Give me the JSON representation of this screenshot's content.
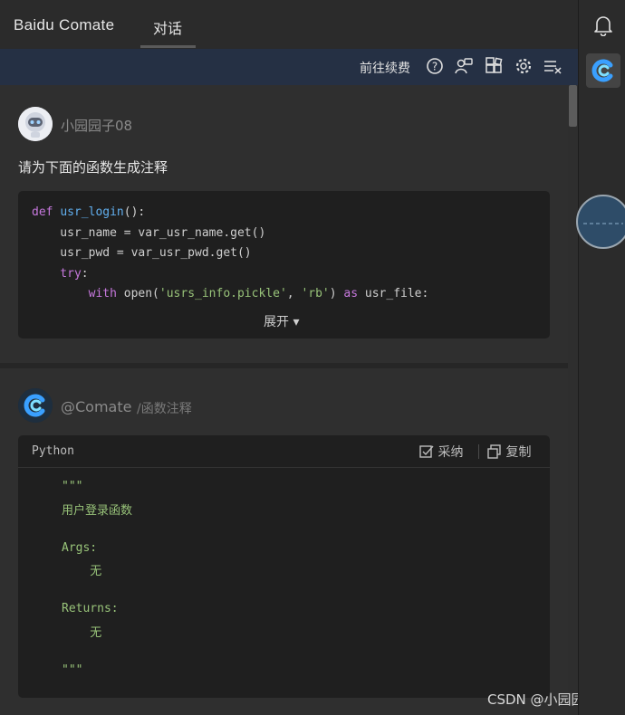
{
  "header": {
    "brand": "Baidu Comate",
    "tab": "对话"
  },
  "toolbar": {
    "renew_label": "前往续费",
    "icons": [
      "help-icon",
      "feedback-icon",
      "plugin-icon",
      "settings-icon",
      "clear-icon"
    ]
  },
  "user_message": {
    "username": "小园园子08",
    "question": "请为下面的函数生成注释",
    "code_lines": [
      {
        "parts": [
          [
            "kw",
            "def "
          ],
          [
            "fn",
            "usr_login"
          ],
          [
            "",
            "():"
          ]
        ]
      },
      {
        "parts": [
          [
            "",
            "    usr_name = var_usr_name.get()"
          ]
        ]
      },
      {
        "parts": [
          [
            "",
            "    usr_pwd = var_usr_pwd.get()"
          ]
        ]
      },
      {
        "parts": [
          [
            "kw",
            "    try"
          ],
          [
            "",
            ":"
          ]
        ]
      },
      {
        "parts": [
          [
            "kw",
            "        with "
          ],
          [
            "",
            "open("
          ],
          [
            "str",
            "'usrs_info.pickle'"
          ],
          [
            "",
            ", "
          ],
          [
            "str",
            "'rb'"
          ],
          [
            "",
            ") "
          ],
          [
            "kw",
            "as"
          ],
          [
            "",
            " usr_file:"
          ]
        ]
      }
    ],
    "expand_label": "展开 ▾"
  },
  "bot_message": {
    "name": "@Comate",
    "command": "/函数注释",
    "language": "Python",
    "adopt_label": "采纳",
    "copy_label": "复制",
    "answer_lines": [
      "\"\"\"",
      "用户登录函数",
      "",
      "Args:",
      "    无",
      "",
      "Returns:",
      "    无",
      "",
      "\"\"\""
    ]
  },
  "watermark": "CSDN @小园园子",
  "colors": {
    "toolbar_bg": "#253044",
    "keyword": "#c678dd",
    "function": "#61afef",
    "string": "#98c379"
  }
}
